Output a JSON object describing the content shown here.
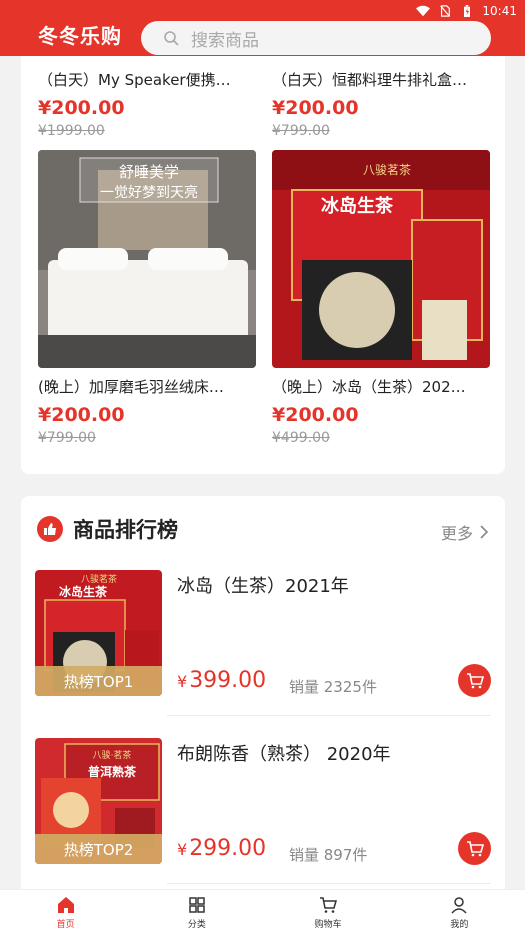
{
  "status_bar": {
    "time": "10:41"
  },
  "header": {
    "app_title": "冬冬乐购",
    "search_placeholder": "搜索商品"
  },
  "products": [
    {
      "name": "（白天）My Speaker便携…",
      "price": "¥200.00",
      "original_price": "¥1999.00"
    },
    {
      "name": "（白天）恒都料理牛排礼盒…",
      "price": "¥200.00",
      "original_price": "¥799.00"
    },
    {
      "name": "(晚上）加厚磨毛羽丝绒床…",
      "price": "¥200.00",
      "original_price": "¥799.00",
      "image_text": [
        "舒睡美学",
        "一觉好梦到天亮"
      ]
    },
    {
      "name": "（晚上）冰岛（生茶）202…",
      "price": "¥200.00",
      "original_price": "¥499.00",
      "image_text": [
        "八骏茗茶",
        "冰岛生茶"
      ]
    }
  ],
  "ranking": {
    "title": "商品排行榜",
    "more_label": "更多",
    "items": [
      {
        "title": "冰岛（生茶）2021年",
        "currency": "¥",
        "price": "399.00",
        "sold": "销量 2325件",
        "tag": "热榜TOP1",
        "image_text": [
          "八骏茗茶",
          "冰岛生茶"
        ]
      },
      {
        "title": "布朗陈香（熟茶） 2020年",
        "currency": "¥",
        "price": "299.00",
        "sold": "销量 897件",
        "tag": "热榜TOP2",
        "image_text": [
          "八骏·茗茶",
          "普洱熟茶"
        ]
      }
    ]
  },
  "tabbar": [
    {
      "label": "首页",
      "icon": "home-icon",
      "active": true
    },
    {
      "label": "分类",
      "icon": "grid-icon",
      "active": false
    },
    {
      "label": "购物车",
      "icon": "cart-icon",
      "active": false
    },
    {
      "label": "我的",
      "icon": "user-icon",
      "active": false
    }
  ],
  "colors": {
    "brand": "#e5352b",
    "background": "#f2f2f2"
  }
}
